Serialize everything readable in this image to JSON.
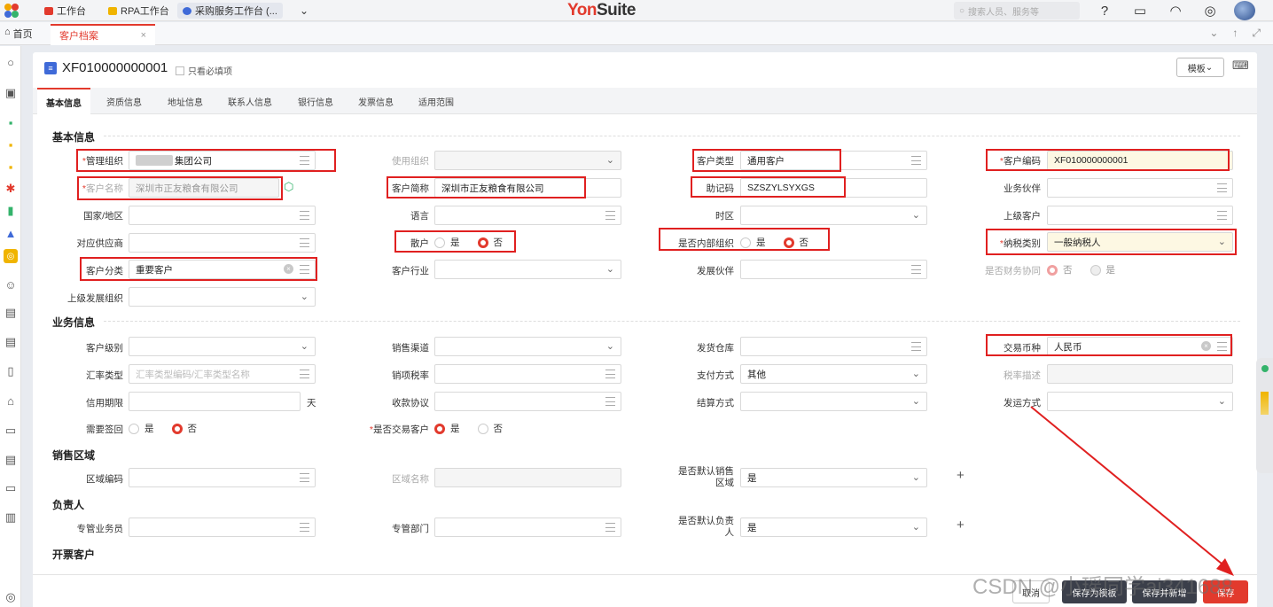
{
  "topbar": {
    "tabs": [
      {
        "label": "工作台",
        "color": "#e23a2d"
      },
      {
        "label": "RPA工作台",
        "color": "#f0b400"
      },
      {
        "label": "采购服务工作台 (...",
        "color": "#3f6ad8"
      }
    ],
    "brand_main": "Yon",
    "brand_suffix": "Suite",
    "search_placeholder": "搜索人员、服务等",
    "icons": [
      "help-icon",
      "message-icon",
      "headset-icon",
      "compass-icon",
      "avatar"
    ]
  },
  "tabbar": {
    "home_label": "首页",
    "active_tab": "客户档案"
  },
  "record": {
    "code": "XF010000000001",
    "required_only_label": "只看必填项",
    "template_button": "模板",
    "tabs": [
      "基本信息",
      "资质信息",
      "地址信息",
      "联系人信息",
      "银行信息",
      "发票信息",
      "适用范围"
    ]
  },
  "sections": {
    "basic": "基本信息",
    "business": "业务信息",
    "sales_area": "销售区域",
    "responsible": "负责人",
    "invoice_customer": "开票客户"
  },
  "basic": {
    "org_label": "管理组织",
    "org_value": "集团公司",
    "use_org_label": "使用组织",
    "type_label": "客户类型",
    "type_value": "通用客户",
    "code_label": "客户编码",
    "code_value": "XF010000000001",
    "name_label": "客户名称",
    "name_value": "深圳市正友粮食有限公司",
    "short_label": "客户简称",
    "short_value": "深圳市正友粮食有限公司",
    "mnemonic_label": "助记码",
    "mnemonic_value": "SZSZYLSYXGS",
    "partner_label": "业务伙伴",
    "country_label": "国家/地区",
    "language_label": "语言",
    "timezone_label": "时区",
    "parent_label": "上级客户",
    "supplier_label": "对应供应商",
    "retail_label": "散户",
    "internal_label": "是否内部组织",
    "tax_label": "纳税类别",
    "tax_value": "一般纳税人",
    "class_label": "客户分类",
    "class_value": "重要客户",
    "industry_label": "客户行业",
    "dev_partner_label": "发展伙伴",
    "fin_label": "是否财务协同",
    "parent_dev_label": "上级发展组织",
    "yes": "是",
    "no": "否"
  },
  "business": {
    "level_label": "客户级别",
    "channel_label": "销售渠道",
    "warehouse_label": "发货仓库",
    "currency_label": "交易币种",
    "currency_value": "人民币",
    "rate_type_label": "汇率类型",
    "rate_type_placeholder": "汇率类型编码/汇率类型名称",
    "tax_rate_label": "销项税率",
    "payment_label": "支付方式",
    "payment_value": "其他",
    "tax_desc_label": "税率描述",
    "credit_label": "信用期限",
    "credit_unit": "天",
    "agreement_label": "收款协议",
    "settle_label": "结算方式",
    "ship_label": "发运方式",
    "sign_label": "需要签回",
    "trade_label": "是否交易客户"
  },
  "sales_area": {
    "code_label": "区域编码",
    "name_label": "区域名称",
    "default_label_1": "是否默认销售",
    "default_label_2": "区域",
    "default_value": "是"
  },
  "responsible": {
    "staff_label": "专管业务员",
    "dept_label": "专管部门",
    "default_label_1": "是否默认负责",
    "default_label_2": "人",
    "default_value": "是"
  },
  "footer": {
    "cancel": "取消",
    "save_template": "保存为模板",
    "save_new": "保存并新增",
    "save": "保存",
    "watermark": "CSDN @小瑶同学ai341688"
  },
  "colors": {
    "accent": "#e23a2d",
    "annotation": "#e02020",
    "highlight": "#fdf8e3"
  }
}
